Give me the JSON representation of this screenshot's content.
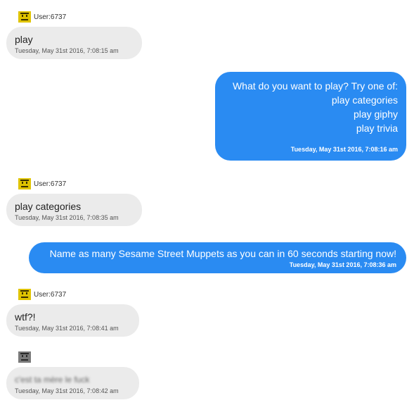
{
  "messages": [
    {
      "direction": "in",
      "user": "User:6737",
      "text": "play",
      "timestamp": "Tuesday, May 31st 2016, 7:08:15 am"
    },
    {
      "direction": "out",
      "lines": [
        "What do you want to play? Try one of:",
        "play categories",
        "play giphy",
        "play trivia"
      ],
      "timestamp": "Tuesday, May 31st 2016, 7:08:16 am"
    },
    {
      "direction": "in",
      "user": "User:6737",
      "text": "play categories",
      "timestamp": "Tuesday, May 31st 2016, 7:08:35 am"
    },
    {
      "direction": "out",
      "text": "Name as many Sesame Street Muppets as you can in 60 seconds starting now!",
      "timestamp": "Tuesday, May 31st 2016, 7:08:36 am"
    },
    {
      "direction": "in",
      "user": "User:6737",
      "text": "wtf?!",
      "timestamp": "Tuesday, May 31st 2016, 7:08:41 am"
    },
    {
      "direction": "in",
      "user": "",
      "text": "c'est ta mère le fuck",
      "text_blurred": true,
      "timestamp": "Tuesday, May 31st 2016, 7:08:42 am"
    }
  ],
  "colors": {
    "outgoing_bubble": "#2a8bf2",
    "incoming_bubble": "#ebebeb",
    "avatar_active": "#e0c400",
    "avatar_inactive": "#7a7a7a"
  },
  "icons": {
    "avatar": "pixel-face-avatar-icon"
  }
}
